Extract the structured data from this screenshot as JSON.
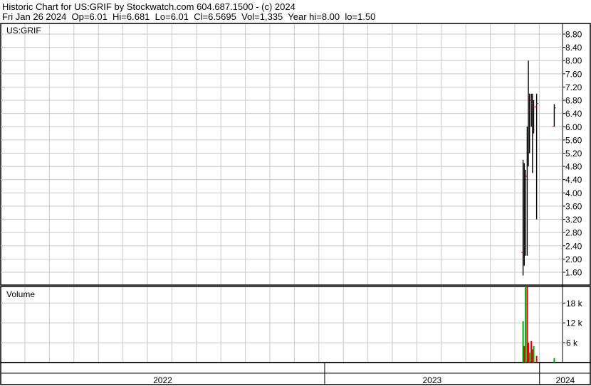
{
  "header": {
    "line1": "Historic Chart for US:GRIF by Stockwatch.com 604.687.1500 - (c) 2024",
    "line2": "Fri Jan 26 2024  Op=6.01  Hi=6.681  Lo=6.01  Cl=6.5695  Vol=1,335  Year hi=8.00  lo=1.50"
  },
  "chart_data": [
    {
      "type": "ohlc",
      "title": "US:GRIF",
      "ylim": [
        1.3,
        9.1
      ],
      "y_ticks": [
        "8.80",
        "8.40",
        "8.00",
        "7.60",
        "7.20",
        "6.80",
        "6.40",
        "6.00",
        "5.60",
        "5.20",
        "4.80",
        "4.40",
        "4.00",
        "3.60",
        "3.20",
        "2.80",
        "2.40",
        "2.00",
        "1.60"
      ],
      "x_labels": [
        "2022",
        "2023",
        "2024"
      ],
      "grid": true,
      "bars": [
        {
          "date": "2023-12-04",
          "open": 2.2,
          "high": 5.0,
          "low": 1.5,
          "close": 4.6
        },
        {
          "date": "2023-12-06",
          "open": 4.6,
          "high": 4.9,
          "low": 1.8,
          "close": 2.4
        },
        {
          "date": "2023-12-08",
          "open": 2.4,
          "high": 4.7,
          "low": 2.1,
          "close": 4.5
        },
        {
          "date": "2023-12-11",
          "open": 4.5,
          "high": 6.0,
          "low": 2.1,
          "close": 5.8
        },
        {
          "date": "2023-12-13",
          "open": 5.8,
          "high": 8.0,
          "low": 4.8,
          "close": 6.5
        },
        {
          "date": "2023-12-15",
          "open": 6.5,
          "high": 7.0,
          "low": 5.2,
          "close": 6.8
        },
        {
          "date": "2023-12-18",
          "open": 6.8,
          "high": 7.0,
          "low": 6.0,
          "close": 6.7
        },
        {
          "date": "2023-12-20",
          "open": 6.7,
          "high": 7.0,
          "low": 4.6,
          "close": 5.9
        },
        {
          "date": "2023-12-22",
          "open": 5.9,
          "high": 6.8,
          "low": 5.8,
          "close": 6.6
        },
        {
          "date": "2023-12-27",
          "open": 6.6,
          "high": 7.0,
          "low": 3.2,
          "close": 6.7
        },
        {
          "date": "2024-01-26",
          "open": 6.01,
          "high": 6.681,
          "low": 6.01,
          "close": 6.5695
        }
      ]
    },
    {
      "type": "bar",
      "title": "Volume",
      "ylim": [
        0,
        23000
      ],
      "y_ticks": [
        "18 k",
        "12 k",
        "6 k"
      ],
      "bars": [
        {
          "date": "2023-12-04",
          "value": 12500,
          "color": "green"
        },
        {
          "date": "2023-12-06",
          "value": 5000,
          "color": "red"
        },
        {
          "date": "2023-12-08",
          "value": 23000,
          "color": "green"
        },
        {
          "date": "2023-12-11",
          "value": 23000,
          "color": "red"
        },
        {
          "date": "2023-12-13",
          "value": 6000,
          "color": "red"
        },
        {
          "date": "2023-12-15",
          "value": 3000,
          "color": "green"
        },
        {
          "date": "2023-12-18",
          "value": 6500,
          "color": "red"
        },
        {
          "date": "2023-12-20",
          "value": 4000,
          "color": "red"
        },
        {
          "date": "2023-12-22",
          "value": 5000,
          "color": "green"
        },
        {
          "date": "2023-12-27",
          "value": 2000,
          "color": "red"
        },
        {
          "date": "2024-01-26",
          "value": 1335,
          "color": "green"
        }
      ]
    }
  ],
  "colors": {
    "up": "#000000",
    "down": "#000000",
    "vol_green": "#00aa00",
    "vol_red": "#dd0000",
    "grid": "#c8c8c8"
  }
}
